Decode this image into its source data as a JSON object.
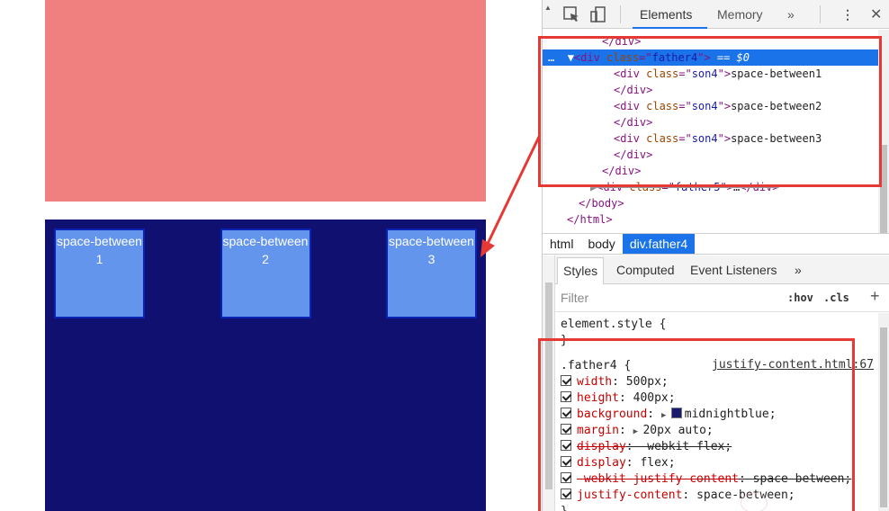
{
  "preview": {
    "boxes": [
      {
        "label": "space-between1"
      },
      {
        "label": "space-between2"
      },
      {
        "label": "space-between3"
      }
    ]
  },
  "devtools": {
    "toolbar": {
      "tabs": [
        "Elements",
        "Memory",
        "»"
      ],
      "active_tab": "Elements"
    },
    "elements": {
      "lines": [
        {
          "indent": 4,
          "kind": "close",
          "tag": "div"
        },
        {
          "indent": 3,
          "kind": "selected",
          "tag": "div",
          "attr": "class",
          "value": "father4",
          "suffix": " == $0"
        },
        {
          "indent": 5,
          "kind": "open-text",
          "tag": "div",
          "attr": "class",
          "value": "son4",
          "text": "space-between1"
        },
        {
          "indent": 5,
          "kind": "close",
          "tag": "div"
        },
        {
          "indent": 5,
          "kind": "open-text",
          "tag": "div",
          "attr": "class",
          "value": "son4",
          "text": "space-between2"
        },
        {
          "indent": 5,
          "kind": "close",
          "tag": "div"
        },
        {
          "indent": 5,
          "kind": "open-text",
          "tag": "div",
          "attr": "class",
          "value": "son4",
          "text": "space-between3"
        },
        {
          "indent": 5,
          "kind": "close",
          "tag": "div"
        },
        {
          "indent": 4,
          "kind": "close",
          "tag": "div"
        },
        {
          "indent": 3,
          "kind": "collapsed",
          "tag": "div",
          "attr": "class",
          "value": "father5",
          "text": "…"
        },
        {
          "indent": 2,
          "kind": "close",
          "tag": "body"
        },
        {
          "indent": 1,
          "kind": "close",
          "tag": "html"
        }
      ]
    },
    "breadcrumb": [
      "html",
      "body",
      "div.father4"
    ],
    "styles_tabs": [
      "Styles",
      "Computed",
      "Event Listeners",
      "»"
    ],
    "filter": {
      "placeholder": "Filter",
      "hov": ":hov",
      "cls": ".cls",
      "add": "+"
    },
    "rules": {
      "element_style": "element.style {",
      "element_close": "}",
      "selector": ".father4 {",
      "source": "justify-content.html:67",
      "declarations": [
        {
          "prop": "width",
          "value": "500px;",
          "strike": false
        },
        {
          "prop": "height",
          "value": "400px;",
          "strike": false
        },
        {
          "prop": "background",
          "value": "midnightblue;",
          "strike": false,
          "swatch": "#191970",
          "expand": true
        },
        {
          "prop": "margin",
          "value": "20px auto;",
          "strike": false,
          "expand": true
        },
        {
          "prop": "display",
          "value": "-webkit-flex;",
          "strike": true
        },
        {
          "prop": "display",
          "value": "flex;",
          "strike": false
        },
        {
          "prop": "-webkit-justify-content",
          "value": "space-between;",
          "strike": true
        },
        {
          "prop": "justify-content",
          "value": "space-between;",
          "strike": false
        }
      ],
      "rule_close": "}"
    }
  },
  "colors": {
    "salmon": "#f08080",
    "midnightblue": "#191970",
    "son4": "#6495ed",
    "highlight": "#1a73e8",
    "annotation": "#e53935"
  }
}
